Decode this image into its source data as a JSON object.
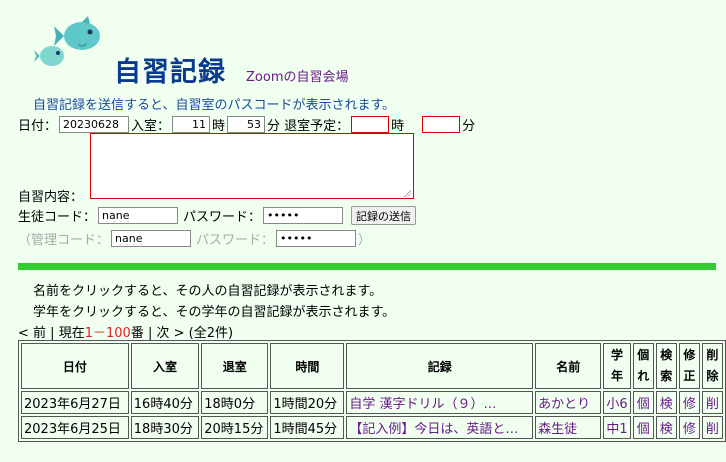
{
  "header": {
    "title": "自習記録",
    "subtitle": "Zoomの自習会場",
    "notice": "自習記録を送信すると、自習室のパスコードが表示されます。"
  },
  "form": {
    "date_label": "日付：",
    "date_value": "20230628",
    "enter_label": "入室：",
    "enter_hour": "11",
    "hour_unit": "時",
    "enter_minute": "53",
    "minute_unit": "分",
    "exit_label": "退室予定：",
    "exit_hour": "",
    "exit_minute": "",
    "content_label": "自習内容：",
    "content_value": "",
    "student_code_label": "生徒コード：",
    "student_code_value": "nane",
    "password_label": "パスワード：",
    "password_value": "•••••",
    "submit_label": "記録の送信",
    "admin_open": "（管理コード：",
    "admin_code_value": "nane",
    "admin_password_label": "パスワード：",
    "admin_password_value": "•••••",
    "admin_close": "）"
  },
  "info": {
    "line1": "名前をクリックすると、その人の自習記録が表示されます。",
    "line2": "学年をクリックすると、その学年の自習記録が表示されます。"
  },
  "pager": {
    "prev": "< 前",
    "sep1": "|",
    "current_prefix": "現在",
    "range": "1－100",
    "current_suffix": "番",
    "sep2": "|",
    "next": "次 >",
    "total": "(全2件)"
  },
  "table": {
    "headers": [
      "日付",
      "入室",
      "退室",
      "時間",
      "記録",
      "名前",
      "学年",
      "個れ",
      "検索",
      "修正",
      "削除"
    ],
    "rows": [
      [
        "2023年6月27日",
        "16時40分",
        "18時0分",
        "1時間20分",
        "自学 漢字ドリル（９）…",
        "あかとり",
        "小6",
        "個",
        "検",
        "修",
        "削"
      ],
      [
        "2023年6月25日",
        "18時30分",
        "20時15分",
        "1時間45分",
        "【記入例】今日は、英語と…",
        "森生徒",
        "中1",
        "個",
        "検",
        "修",
        "削"
      ]
    ]
  },
  "colors": {
    "background": "#f0fff0",
    "title": "#0a3a8f",
    "link": "#6a1a8a",
    "bar": "#33cc33",
    "notice": "#1a4aa0"
  }
}
